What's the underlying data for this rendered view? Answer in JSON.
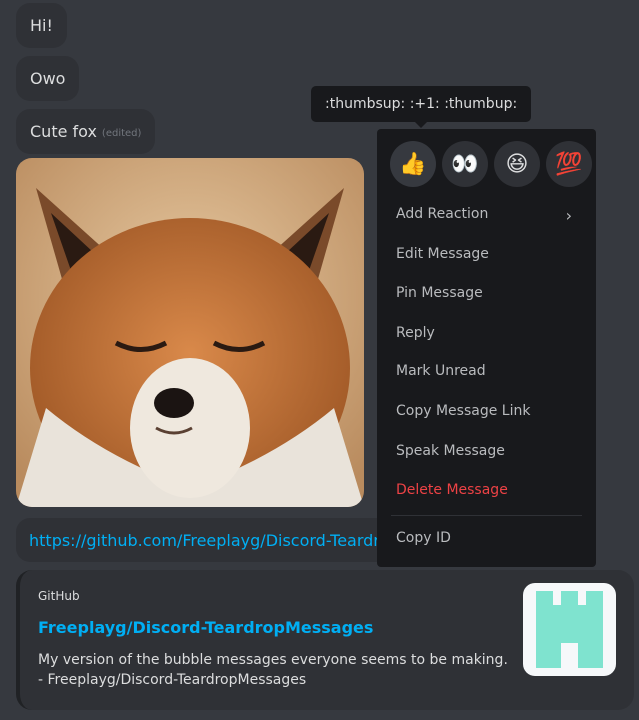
{
  "messages": [
    {
      "text": "Hi!"
    },
    {
      "text": "Owo"
    },
    {
      "text": "Cute fox",
      "edited": "(edited)"
    }
  ],
  "link_message": {
    "url": "https://github.com/Freeplayg/Discord-Teardro"
  },
  "embed": {
    "provider": "GitHub",
    "title": "Freeplayg/Discord-TeardropMessages",
    "description": "My version of the bubble messages everyone seems to be making. - Freeplayg/Discord-TeardropMessages"
  },
  "tooltip": ":thumbsup: :+1: :thumbup:",
  "reactions": [
    {
      "emoji": "👍",
      "icon": "thumbs-up-icon"
    },
    {
      "emoji": "👀",
      "icon": "eyes-icon"
    },
    {
      "emoji": "😆",
      "icon": "laughing-icon"
    },
    {
      "emoji": "💯",
      "icon": "hundred-points-icon"
    }
  ],
  "menu": {
    "add_reaction": "Add Reaction",
    "edit_message": "Edit Message",
    "pin_message": "Pin Message",
    "reply": "Reply",
    "mark_unread": "Mark Unread",
    "copy_message_link": "Copy Message Link",
    "speak_message": "Speak Message",
    "delete_message": "Delete Message",
    "copy_id": "Copy ID"
  },
  "colors": {
    "background": "#36393f",
    "bubble": "#2f3136",
    "menu": "#18191c",
    "link": "#00aff4",
    "danger": "#ed4245"
  }
}
